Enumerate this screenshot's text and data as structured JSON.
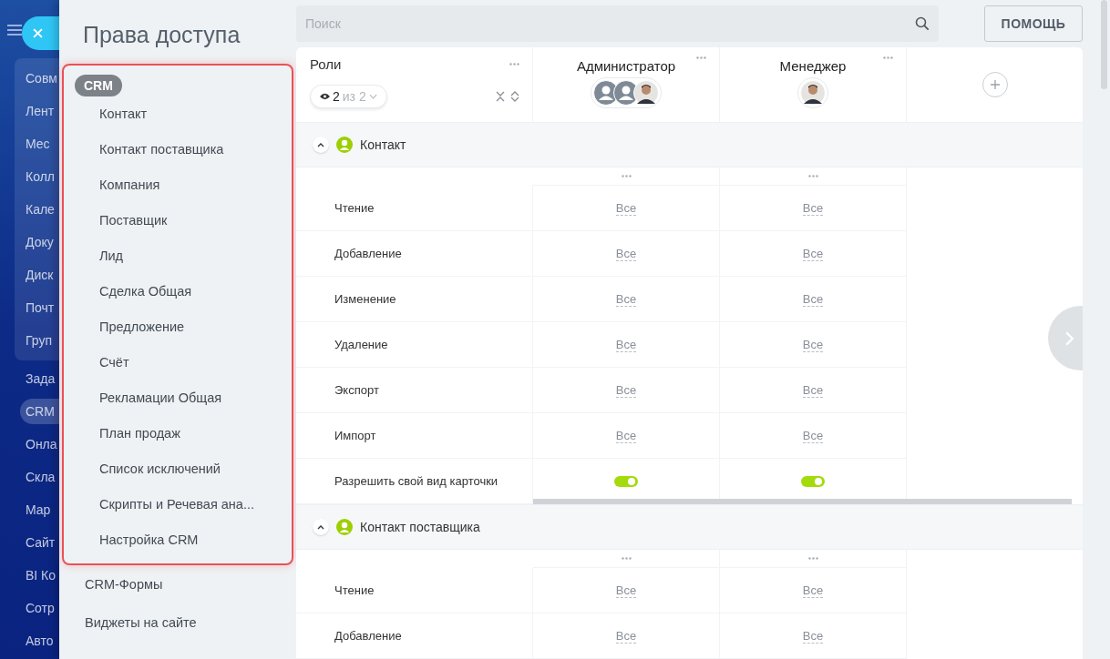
{
  "nav": {
    "items": [
      {
        "label": "Совм",
        "selected": false,
        "grouped": true
      },
      {
        "label": "Лент",
        "selected": false,
        "grouped": true
      },
      {
        "label": "Мес",
        "selected": false,
        "grouped": true
      },
      {
        "label": "Колл",
        "selected": false,
        "grouped": true
      },
      {
        "label": "Кале",
        "selected": false,
        "grouped": true
      },
      {
        "label": "Доку",
        "selected": false,
        "grouped": true
      },
      {
        "label": "Диск",
        "selected": false,
        "grouped": true
      },
      {
        "label": "Почт",
        "selected": false,
        "grouped": true
      },
      {
        "label": "Груп",
        "selected": false,
        "grouped": true
      },
      {
        "label": "Зада",
        "selected": false,
        "grouped": false
      },
      {
        "label": "CRM",
        "selected": true,
        "grouped": false
      },
      {
        "label": "Онла",
        "selected": false,
        "grouped": false
      },
      {
        "label": "Скла",
        "selected": false,
        "grouped": false
      },
      {
        "label": "Мар",
        "selected": false,
        "grouped": false
      },
      {
        "label": "Сайт",
        "selected": false,
        "grouped": false
      },
      {
        "label": "BI Ко",
        "selected": false,
        "grouped": false
      },
      {
        "label": "Сотр",
        "selected": false,
        "grouped": false
      },
      {
        "label": "Авто",
        "selected": false,
        "grouped": false
      }
    ]
  },
  "page": {
    "title": "Права доступа"
  },
  "search": {
    "placeholder": "Поиск"
  },
  "help_button": "ПОМОЩЬ",
  "menu": {
    "group": "CRM",
    "items": [
      {
        "label": "Контакт",
        "selected": false
      },
      {
        "label": "Контакт поставщика",
        "selected": false
      },
      {
        "label": "Компания",
        "selected": false
      },
      {
        "label": "Поставщик",
        "selected": false
      },
      {
        "label": "Лид",
        "selected": false
      },
      {
        "label": "Сделка Общая",
        "selected": false
      },
      {
        "label": "Предложение",
        "selected": false
      },
      {
        "label": "Счёт",
        "selected": false
      },
      {
        "label": "Рекламации Общая",
        "selected": false
      },
      {
        "label": "План продаж",
        "selected": false
      },
      {
        "label": "Список исключений",
        "selected": false
      },
      {
        "label": "Скрипты и Речевая ана...",
        "selected": false
      },
      {
        "label": "Настройка CRM",
        "selected": false
      }
    ],
    "other_items": [
      "CRM-Формы",
      "Виджеты на сайте"
    ]
  },
  "table": {
    "roles_header": "Роли",
    "filter": {
      "count": "2",
      "total": "из 2"
    },
    "roles": [
      {
        "name": "Администратор",
        "avatars": [
          {
            "kind": "placeholder"
          },
          {
            "kind": "placeholder"
          },
          {
            "kind": "photo"
          }
        ]
      },
      {
        "name": "Менеджер",
        "avatars": [
          {
            "kind": "photo"
          }
        ]
      }
    ],
    "sections": [
      {
        "title": "Контакт",
        "expanded": true,
        "rows": [
          {
            "label": "Чтение",
            "kind": "value",
            "cells": [
              {
                "text": "Все"
              },
              {
                "text": "Все"
              }
            ]
          },
          {
            "label": "Добавление",
            "kind": "value",
            "cells": [
              {
                "text": "Все"
              },
              {
                "text": "Все"
              }
            ]
          },
          {
            "label": "Изменение",
            "kind": "value",
            "cells": [
              {
                "text": "Все"
              },
              {
                "text": "Все"
              }
            ]
          },
          {
            "label": "Удаление",
            "kind": "value",
            "cells": [
              {
                "text": "Все"
              },
              {
                "text": "Все"
              }
            ]
          },
          {
            "label": "Экспорт",
            "kind": "value",
            "cells": [
              {
                "text": "Все"
              },
              {
                "text": "Все"
              }
            ]
          },
          {
            "label": "Импорт",
            "kind": "value",
            "cells": [
              {
                "text": "Все"
              },
              {
                "text": "Все"
              }
            ]
          },
          {
            "label": "Разрешить свой вид карточки",
            "kind": "toggle",
            "cells": [
              {
                "on": true
              },
              {
                "on": true
              }
            ]
          }
        ]
      },
      {
        "title": "Контакт поставщика",
        "expanded": true,
        "rows": [
          {
            "label": "Чтение",
            "kind": "value",
            "cells": [
              {
                "text": "Все"
              },
              {
                "text": "Все"
              }
            ]
          },
          {
            "label": "Добавление",
            "kind": "value",
            "cells": [
              {
                "text": "Все"
              },
              {
                "text": "Все"
              }
            ]
          }
        ]
      }
    ]
  }
}
